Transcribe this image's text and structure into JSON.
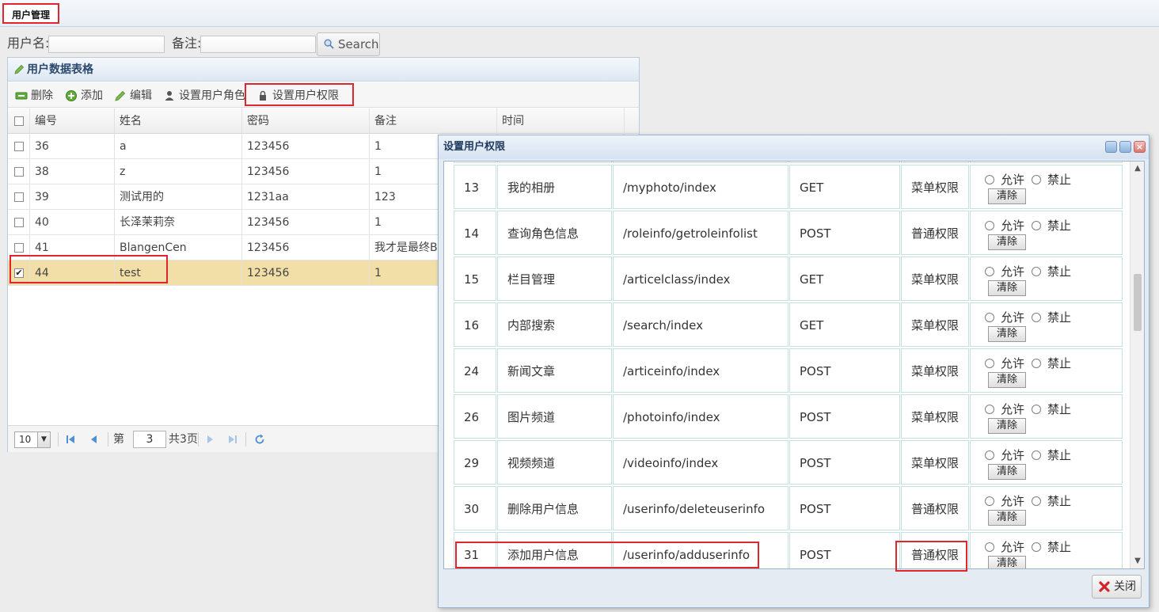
{
  "top_tab": {
    "label": "用户管理"
  },
  "search": {
    "username_label": "用户名:",
    "remark_label": "备注:",
    "button_label": "Search"
  },
  "panel": {
    "title": "用户数据表格",
    "toolbar": {
      "delete": "删除",
      "add": "添加",
      "edit": "编辑",
      "set_role": "设置用户角色",
      "set_permission": "设置用户权限"
    },
    "columns": [
      "编号",
      "姓名",
      "密码",
      "备注",
      "时间"
    ],
    "rows": [
      {
        "id": "36",
        "name": "a",
        "password": "123456",
        "remark": "1",
        "checked": false
      },
      {
        "id": "38",
        "name": "z",
        "password": "123456",
        "remark": "1",
        "checked": false
      },
      {
        "id": "39",
        "name": "测试用的",
        "password": "1231aa",
        "remark": "123",
        "checked": false
      },
      {
        "id": "40",
        "name": "长泽茉莉奈",
        "password": "123456",
        "remark": "1",
        "checked": false
      },
      {
        "id": "41",
        "name": "BlangenCen",
        "password": "123456",
        "remark": "我才是最终BO",
        "checked": false
      },
      {
        "id": "44",
        "name": "test",
        "password": "123456",
        "remark": "1",
        "checked": true
      }
    ],
    "pager": {
      "page_size": "10",
      "page_prefix": "第",
      "current_page": "3",
      "total_text": "共3页"
    }
  },
  "dialog": {
    "title": "设置用户权限",
    "allow_label": "允许",
    "deny_label": "禁止",
    "clear_label": "清除",
    "close_label": "关闭",
    "rows": [
      {
        "id": "13",
        "name": "我的相册",
        "url": "/myphoto/index",
        "method": "GET",
        "type": "菜单权限"
      },
      {
        "id": "14",
        "name": "查询角色信息",
        "url": "/roleinfo/getroleinfolist",
        "method": "POST",
        "type": "普通权限"
      },
      {
        "id": "15",
        "name": "栏目管理",
        "url": "/articelclass/index",
        "method": "GET",
        "type": "菜单权限"
      },
      {
        "id": "16",
        "name": "内部搜索",
        "url": "/search/index",
        "method": "GET",
        "type": "菜单权限"
      },
      {
        "id": "24",
        "name": "新闻文章",
        "url": "/articeinfo/index",
        "method": "POST",
        "type": "菜单权限"
      },
      {
        "id": "26",
        "name": "图片频道",
        "url": "/photoinfo/index",
        "method": "POST",
        "type": "菜单权限"
      },
      {
        "id": "29",
        "name": "视频频道",
        "url": "/videoinfo/index",
        "method": "POST",
        "type": "菜单权限"
      },
      {
        "id": "30",
        "name": "删除用户信息",
        "url": "/userinfo/deleteuserinfo",
        "method": "POST",
        "type": "普通权限"
      },
      {
        "id": "31",
        "name": "添加用户信息",
        "url": "/userinfo/adduserinfo",
        "method": "POST",
        "type": "普通权限"
      }
    ]
  },
  "colors": {
    "highlight": "#e0262c",
    "selected_row": "#f2dfa8",
    "panel_border": "#b8cbe0",
    "title_text": "#2c4a6e"
  }
}
